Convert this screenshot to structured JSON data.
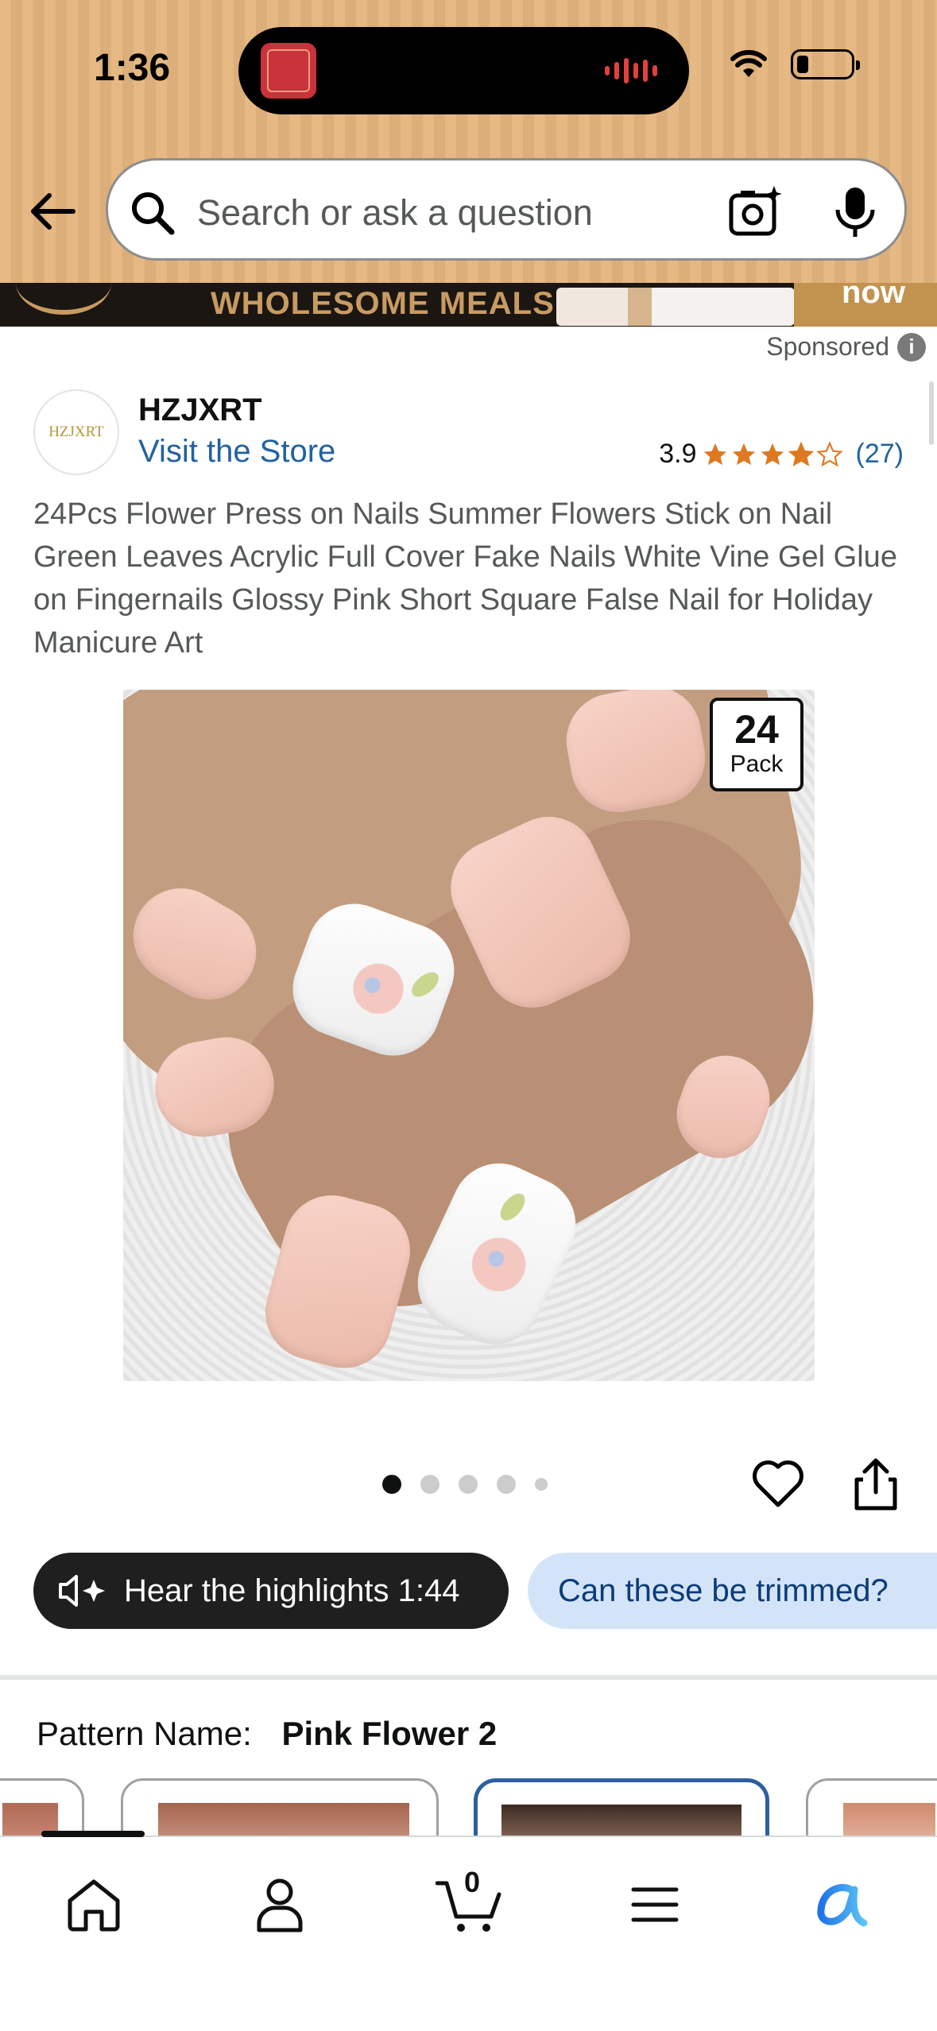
{
  "status_bar": {
    "time": "1:36",
    "island_activity": "audio-waveform"
  },
  "header": {
    "search_placeholder": "Search or ask a question"
  },
  "ad": {
    "banner_text": "WHOLESOME MEALS.",
    "side_text": "now",
    "sponsored_label": "Sponsored",
    "info_glyph": "i"
  },
  "store": {
    "logo_text": "HZJXRT",
    "brand": "HZJXRT",
    "visit_label": "Visit the Store",
    "rating": "3.9",
    "rating_count": "(27)",
    "stars_filled": 3.9,
    "star_color": "#de7921"
  },
  "product": {
    "title": "24Pcs Flower Press on Nails Summer Flowers Stick on Nail Green Leaves Acrylic Full Cover Fake Nails White Vine Gel Glue on Fingernails Glossy Pink Short Square False Nail for Holiday Manicure Art",
    "pack_number": "24",
    "pack_label": "Pack"
  },
  "carousel": {
    "total": 5,
    "active_index": 0
  },
  "actions": {
    "hear_highlights": "Hear the highlights 1:44",
    "question_pill": "Can these be trimmed?"
  },
  "pattern": {
    "label": "Pattern Name:",
    "value": "Pink Flower 2"
  },
  "tabbar": {
    "cart_count": "0",
    "items": [
      "home",
      "account",
      "cart",
      "menu",
      "rufus"
    ],
    "active": "home"
  },
  "colors": {
    "header_bg": "#e6b984",
    "link": "#2162a1",
    "selected_border": "#2c5fa0",
    "pill_light": "#d4e4f8",
    "pill_dark": "#1f1f1f"
  }
}
